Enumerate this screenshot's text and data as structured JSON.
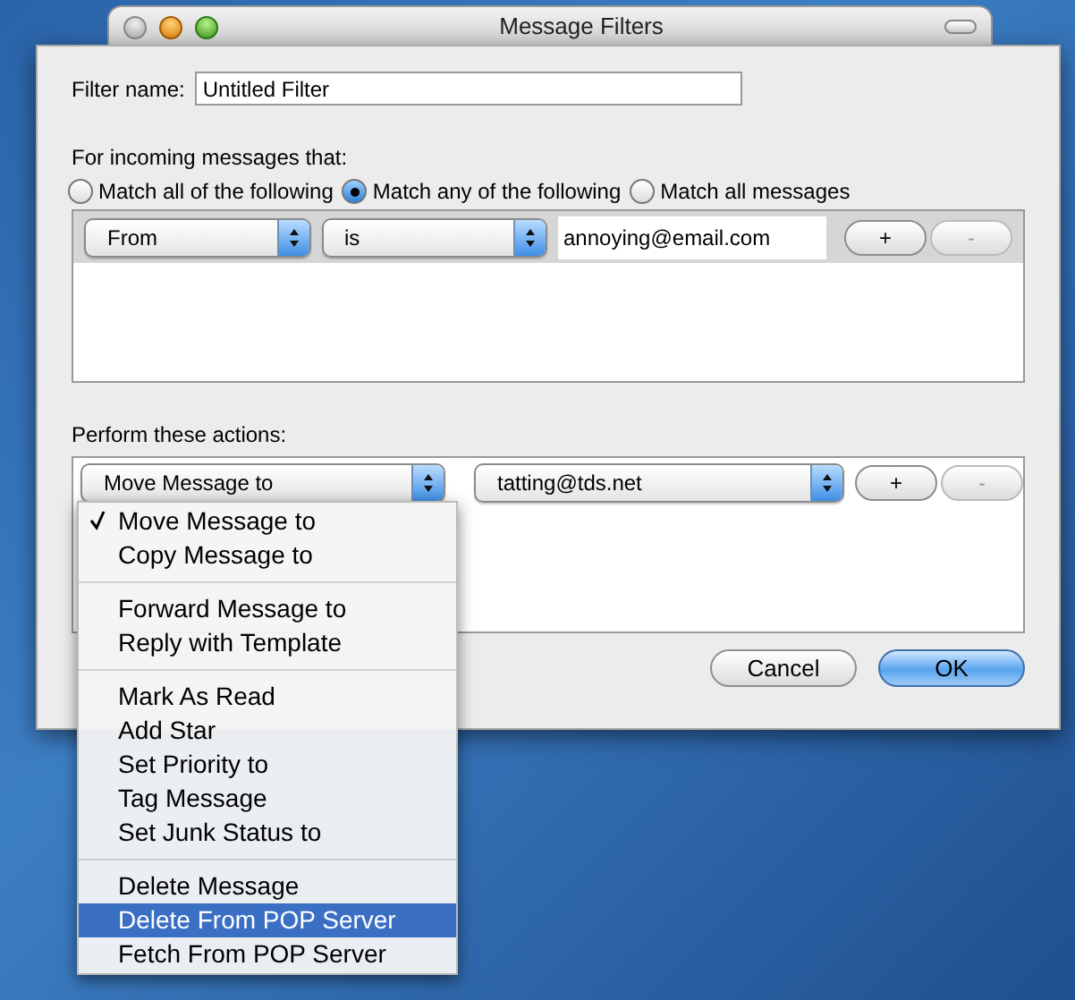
{
  "window": {
    "title": "Message Filters"
  },
  "filter_name": {
    "label": "Filter name:",
    "value": "Untitled Filter"
  },
  "conditions": {
    "label": "For incoming messages that:",
    "match_options": [
      {
        "label": "Match all of the following",
        "selected": false
      },
      {
        "label": "Match any of the following",
        "selected": true
      },
      {
        "label": "Match all messages",
        "selected": false
      }
    ],
    "rules": [
      {
        "field": "From",
        "operator": "is",
        "value": "annoying@email.com",
        "add": "+",
        "remove": "-"
      }
    ]
  },
  "actions": {
    "label": "Perform these actions:",
    "rules": [
      {
        "action": "Move Message to",
        "target": "tatting@tds.net",
        "add": "+",
        "remove": "-"
      }
    ]
  },
  "buttons": [
    {
      "label": "Cancel",
      "kind": "normal"
    },
    {
      "label": "OK",
      "kind": "default"
    }
  ],
  "action_menu": {
    "groups": [
      [
        {
          "label": "Move Message to",
          "checked": true,
          "selected": false
        },
        {
          "label": "Copy Message to",
          "checked": false,
          "selected": false
        }
      ],
      [
        {
          "label": "Forward Message to",
          "checked": false,
          "selected": false
        },
        {
          "label": "Reply with Template",
          "checked": false,
          "selected": false
        }
      ],
      [
        {
          "label": "Mark As Read",
          "checked": false,
          "selected": false
        },
        {
          "label": "Add Star",
          "checked": false,
          "selected": false
        },
        {
          "label": "Set Priority to",
          "checked": false,
          "selected": false
        },
        {
          "label": "Tag Message",
          "checked": false,
          "selected": false
        },
        {
          "label": "Set Junk Status to",
          "checked": false,
          "selected": false
        }
      ],
      [
        {
          "label": "Delete Message",
          "checked": false,
          "selected": false
        },
        {
          "label": "Delete From POP Server",
          "checked": false,
          "selected": true
        },
        {
          "label": "Fetch From POP Server",
          "checked": false,
          "selected": false
        }
      ]
    ]
  }
}
